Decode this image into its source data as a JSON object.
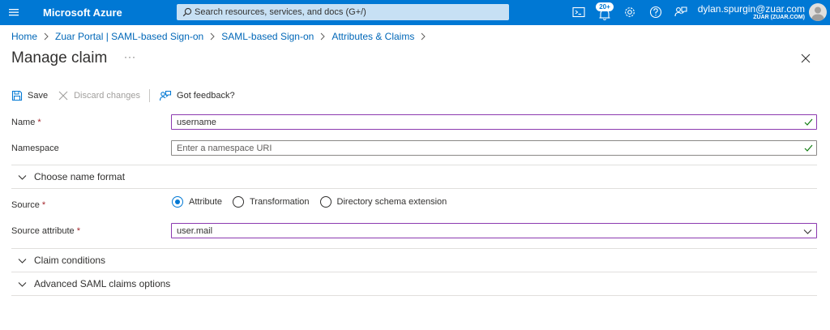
{
  "topbar": {
    "brand": "Microsoft Azure",
    "search_placeholder": "Search resources, services, and docs (G+/)",
    "notification_count": "20+",
    "user_name": "dylan.spurgin@zuar.com",
    "user_tenant": "ZUAR (ZUAR.COM)",
    "icons": [
      "hamburger-icon",
      "cloud-shell-icon",
      "notifications-icon",
      "settings-icon",
      "help-icon",
      "feedback-icon"
    ]
  },
  "breadcrumb": {
    "items": [
      "Home",
      "Zuar Portal | SAML-based Sign-on",
      "SAML-based Sign-on",
      "Attributes & Claims"
    ]
  },
  "page": {
    "title": "Manage claim",
    "more": "···"
  },
  "toolbar": {
    "save_label": "Save",
    "discard_label": "Discard changes",
    "feedback_label": "Got feedback?"
  },
  "form": {
    "name": {
      "label": "Name",
      "required_mark": "*",
      "value": "username"
    },
    "namespace": {
      "label": "Namespace",
      "placeholder": "Enter a namespace URI",
      "value": ""
    },
    "choose_name_format": "Choose name format",
    "source": {
      "label": "Source",
      "required_mark": "*",
      "options": [
        "Attribute",
        "Transformation",
        "Directory schema extension"
      ],
      "selected": "Attribute"
    },
    "source_attribute": {
      "label": "Source attribute",
      "required_mark": "*",
      "value": "user.mail"
    },
    "claim_conditions": "Claim conditions",
    "advanced_options": "Advanced SAML claims options"
  },
  "colors": {
    "topbar": "#0078d4",
    "link": "#0067b8",
    "required": "#a4262c",
    "active_border": "#8c3ab0",
    "check": "#107c10"
  }
}
